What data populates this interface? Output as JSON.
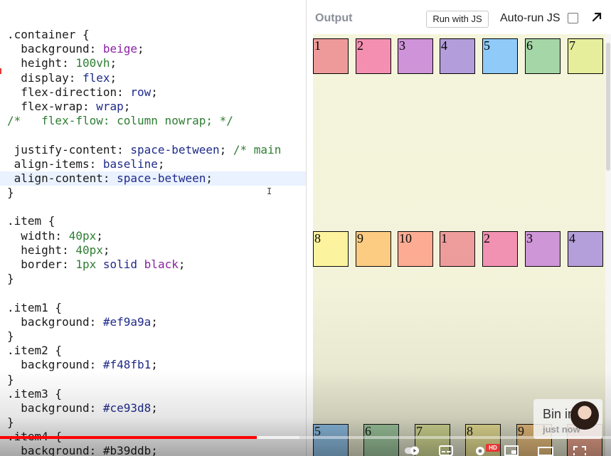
{
  "editor": {
    "lines": [
      [
        {
          "t": ".container {",
          "c": "sel"
        }
      ],
      [
        {
          "t": "  background: ",
          "c": "prop"
        },
        {
          "t": "beige",
          "c": "val"
        },
        {
          "t": ";",
          "c": "prop"
        }
      ],
      [
        {
          "t": "  height: ",
          "c": "prop"
        },
        {
          "t": "100vh",
          "c": "num"
        },
        {
          "t": ";",
          "c": "prop"
        }
      ],
      [
        {
          "t": "  display: ",
          "c": "prop"
        },
        {
          "t": "flex",
          "c": "kw"
        },
        {
          "t": ";",
          "c": "prop"
        }
      ],
      [
        {
          "t": "  flex-direction: ",
          "c": "prop"
        },
        {
          "t": "row",
          "c": "kw"
        },
        {
          "t": ";",
          "c": "prop"
        }
      ],
      [
        {
          "t": "  flex-wrap: ",
          "c": "prop"
        },
        {
          "t": "wrap",
          "c": "kw"
        },
        {
          "t": ";",
          "c": "prop"
        }
      ],
      [
        {
          "t": "/*   flex-flow: column nowrap; */",
          "c": "comment"
        }
      ],
      [
        {
          "t": "",
          "c": "prop"
        }
      ],
      [
        {
          "t": " justify-content: ",
          "c": "prop"
        },
        {
          "t": "space-between",
          "c": "kw"
        },
        {
          "t": "; ",
          "c": "prop"
        },
        {
          "t": "/* main",
          "c": "comment"
        }
      ],
      [
        {
          "t": " align-items: ",
          "c": "prop"
        },
        {
          "t": "baseline",
          "c": "kw"
        },
        {
          "t": ";",
          "c": "prop"
        }
      ],
      [
        {
          "t": " align-content: ",
          "c": "prop"
        },
        {
          "t": "space-between",
          "c": "kw"
        },
        {
          "t": ";",
          "c": "prop"
        }
      ],
      [
        {
          "t": "}",
          "c": "prop"
        }
      ],
      [
        {
          "t": "",
          "c": "prop"
        }
      ],
      [
        {
          "t": ".item {",
          "c": "sel"
        }
      ],
      [
        {
          "t": "  width: ",
          "c": "prop"
        },
        {
          "t": "40px",
          "c": "num"
        },
        {
          "t": ";",
          "c": "prop"
        }
      ],
      [
        {
          "t": "  height: ",
          "c": "prop"
        },
        {
          "t": "40px",
          "c": "num"
        },
        {
          "t": ";",
          "c": "prop"
        }
      ],
      [
        {
          "t": "  border: ",
          "c": "prop"
        },
        {
          "t": "1px",
          "c": "num"
        },
        {
          "t": " solid ",
          "c": "kw"
        },
        {
          "t": "black",
          "c": "val"
        },
        {
          "t": ";",
          "c": "prop"
        }
      ],
      [
        {
          "t": "}",
          "c": "prop"
        }
      ],
      [
        {
          "t": "",
          "c": "prop"
        }
      ],
      [
        {
          "t": ".item1 {",
          "c": "sel"
        }
      ],
      [
        {
          "t": "  background: ",
          "c": "prop"
        },
        {
          "t": "#ef9a9a",
          "c": "hex"
        },
        {
          "t": ";",
          "c": "prop"
        }
      ],
      [
        {
          "t": "}",
          "c": "prop"
        }
      ],
      [
        {
          "t": ".item2 {",
          "c": "sel"
        }
      ],
      [
        {
          "t": "  background: ",
          "c": "prop"
        },
        {
          "t": "#f48fb1",
          "c": "hex"
        },
        {
          "t": ";",
          "c": "prop"
        }
      ],
      [
        {
          "t": "}",
          "c": "prop"
        }
      ],
      [
        {
          "t": ".item3 {",
          "c": "sel"
        }
      ],
      [
        {
          "t": "  background: ",
          "c": "prop"
        },
        {
          "t": "#ce93d8",
          "c": "hex"
        },
        {
          "t": ";",
          "c": "prop"
        }
      ],
      [
        {
          "t": "}",
          "c": "prop"
        }
      ],
      [
        {
          "t": ".item4 {",
          "c": "sel"
        }
      ],
      [
        {
          "t": "  background: #b39ddb;",
          "c": "prop"
        }
      ]
    ],
    "active_line": 10,
    "text_cursor_glyph": "I"
  },
  "output": {
    "title": "Output",
    "run_button_label": "Run with JS",
    "autorun_label": "Auto-run JS",
    "autorun_checked": false,
    "popout_icon": "arrow-up-right-icon",
    "stage_color": "#f5f5dc",
    "items": [
      {
        "label": "1",
        "color": "#ef9a9a"
      },
      {
        "label": "2",
        "color": "#f48fb1"
      },
      {
        "label": "3",
        "color": "#ce93d8"
      },
      {
        "label": "4",
        "color": "#b39ddb"
      },
      {
        "label": "5",
        "color": "#90caf9"
      },
      {
        "label": "6",
        "color": "#a5d6a7"
      },
      {
        "label": "7",
        "color": "#e6ee9c"
      },
      {
        "label": "8",
        "color": "#fff59d"
      },
      {
        "label": "9",
        "color": "#ffcc80"
      },
      {
        "label": "10",
        "color": "#ffab91"
      },
      {
        "label": "1",
        "color": "#ef9a9a"
      },
      {
        "label": "2",
        "color": "#f48fb1"
      },
      {
        "label": "3",
        "color": "#ce93d8"
      },
      {
        "label": "4",
        "color": "#b39ddb"
      },
      {
        "label": "5",
        "color": "#90caf9"
      },
      {
        "label": "6",
        "color": "#a5d6a7"
      },
      {
        "label": "7",
        "color": "#e6ee9c"
      },
      {
        "label": "8",
        "color": "#fff59d"
      },
      {
        "label": "9",
        "color": "#ffcc80"
      },
      {
        "label": "",
        "color": "#ffab91"
      }
    ]
  },
  "video": {
    "progress_played": 0.42,
    "progress_buffered": 0.49,
    "watermark_name": "Bin in",
    "watermark_status": "just now",
    "hd_badge": "HD",
    "accent": "#ff0000"
  }
}
